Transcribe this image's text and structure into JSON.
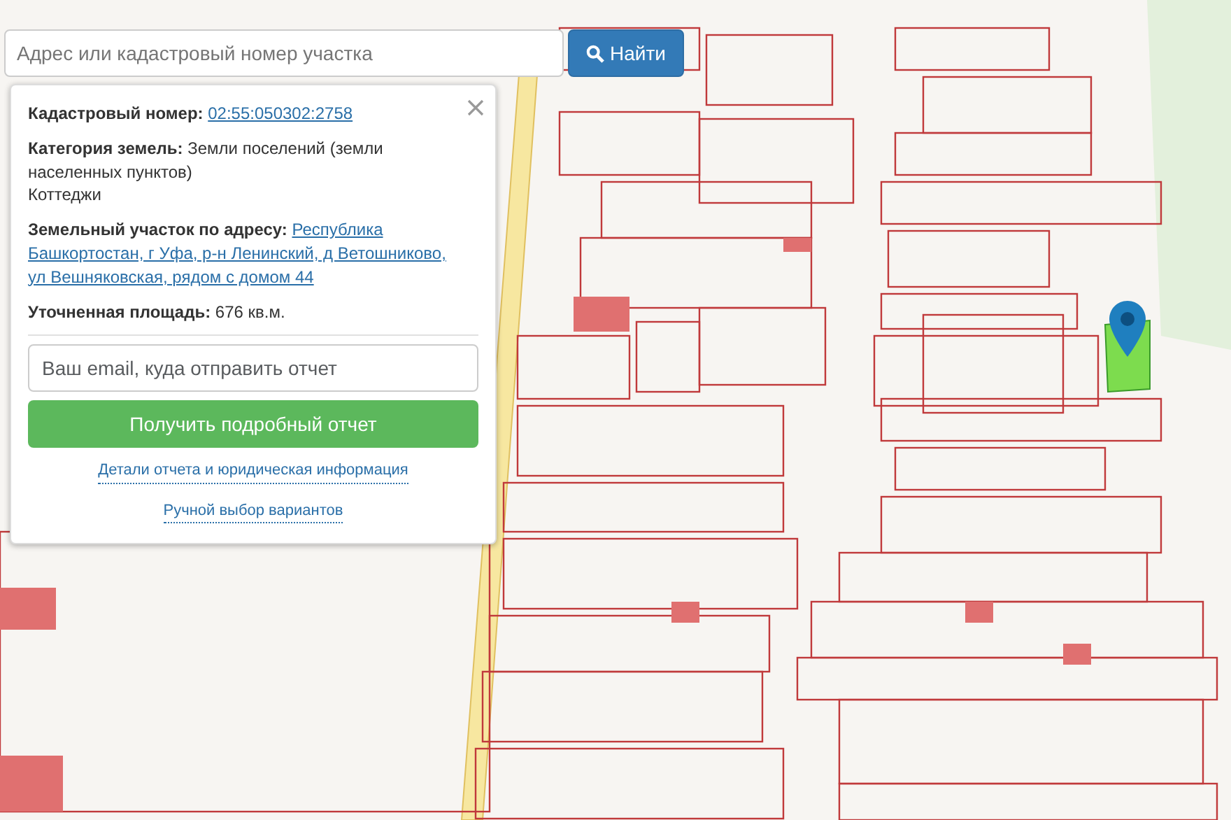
{
  "search": {
    "placeholder": "Адрес или кадастровый номер участка",
    "button": "Найти"
  },
  "info_panel": {
    "fields": [
      {
        "label": "Кадастровый номер:",
        "value": "02:55:050302:2758",
        "kind": "link"
      },
      {
        "label": "Категория земель:",
        "value": "Земли поселений (земли населенных пунктов)",
        "note": "Коттеджи",
        "kind": "text"
      },
      {
        "label": "Земельный участок по адресу:",
        "value": "Республика Башкортостан, г Уфа, р-н Ленинский, д Ветошниково, ул Вешняковская, рядом с домом 44",
        "kind": "link"
      },
      {
        "label": "Уточненная площадь:",
        "value": "676 кв.м.",
        "kind": "text"
      }
    ],
    "email": {
      "placeholder": "Ваш email, куда отправить отчет"
    },
    "submit": "Получить подробный отчет",
    "links": [
      "Детали отчета и юридическая информация",
      "Ручной выбор вариантов"
    ]
  }
}
